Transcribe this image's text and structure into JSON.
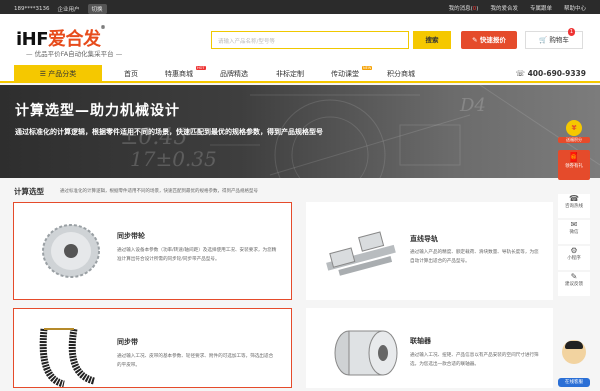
{
  "topbar": {
    "phone_masked": "189****3136",
    "user_type": "企业用户",
    "switch": "切换",
    "msg_prefix": "我的消息(",
    "msg_count": "0",
    "msg_suffix": ")",
    "my": "我的爱合发",
    "shop": "专属跟单",
    "help": "帮助中心"
  },
  "header": {
    "logo_en": "iHF",
    "logo_cn": "爱合发",
    "logo_mark": "®",
    "slogan": "— 优品平价FA自动化集采平台 —",
    "search_placeholder": "请输入产品名称/型号等",
    "search_btn": "搜索",
    "quote_btn": "快速报价",
    "cart_label": "购物车",
    "cart_count": "1"
  },
  "nav": {
    "category": "☰  产品分类",
    "items": [
      "首页",
      "特惠商城",
      "品牌精选",
      "非标定制",
      "传动课堂",
      "积分商城"
    ],
    "hot_tag": "HOT",
    "new_tag": "NEW",
    "phone": "400-690-9339"
  },
  "hero": {
    "title": "计算选型—助力机械设计",
    "subtitle": "通过标准化的计算逻辑，根据零件适用不同的场景，快速匹配到最优的规格参数，得到产品规格型号",
    "bg_text_1": "±0.45",
    "bg_text_2": "17±0.35",
    "bg_text_3": "D4"
  },
  "section": {
    "title": "计算选型",
    "desc": "通过标准化的计算逻辑，根据零件适用不同的场景，快速匹配到最优的规格参数，得到产品规格型号"
  },
  "cards": [
    {
      "title": "同步带轮",
      "desc": "通过输入设备本参数（功率/转速/轴间距）及选择使用工况、安装要求，为您精准计算出符合设计所需的同步轮/同步带产品型号。"
    },
    {
      "title": "直线导轨",
      "desc": "通过输入产品的精度、额定载荷、滑块数量、导轨长度等，为您自动计算出适合的产品型号。"
    },
    {
      "title": "同步带",
      "desc": "通过输入工况、皮带的基本参数、轮径要求、附件的可选加工等，筛选出适合的平皮带。"
    },
    {
      "title": "联轴器",
      "desc": "通过输入工况、扭矩、产品信息以有产品安装的空间尺寸进行筛选，为您选出一款合适的联轴器。"
    }
  ],
  "sidebar": {
    "coin_label": "送福积分",
    "gift_label": "领券有礼",
    "items": [
      "咨询热线",
      "微信",
      "小程序",
      "建议反馈"
    ],
    "online": "在线客服"
  },
  "colors": {
    "accent": "#f5c800",
    "red": "#e54b2b",
    "dark": "#2b2b2b"
  }
}
